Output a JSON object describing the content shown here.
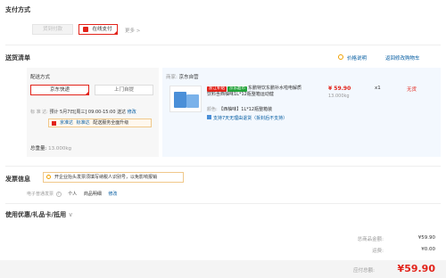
{
  "payment": {
    "title": "支付方式",
    "opt_cod": "货到付款",
    "opt_online": "在线支付",
    "more": "更多 >"
  },
  "delivery": {
    "title": "送货清单",
    "price_note": "价格说明",
    "back_cart": "返回修改购物车",
    "method_title": "配送方式",
    "opt_jd": "京东快递",
    "opt_pickup": "上门自提",
    "std_label": "标 准 达:",
    "std_time": "预计 5月7日[周三] 09:00-15:00 送达",
    "std_edit": "修改",
    "bar_text": "京准达 · 标准达 · 配送服务全面升级",
    "bar_jzd": "京准达",
    "bar_bzd": "标准达",
    "bar_up": "配送服务全面升级",
    "total_weight_label": "总重量:",
    "total_weight": "13.000kg"
  },
  "seller": {
    "label": "商家:",
    "name": "京东自营"
  },
  "product": {
    "tag1": "浙江补贴",
    "tag2": "京东超市",
    "title": "东鹏特饮东鹏补水啦电解质饮料含西柚味1L*12瓶整箱运动健",
    "price": "¥ 59.90",
    "qty": "x1",
    "stock": "无货",
    "weight": "13.000kg",
    "color_label": "颜色:",
    "color_value": "【西柚味】1L*12瓶整箱装",
    "service": "支持7天无理由退货（拆封后不支持）"
  },
  "invoice": {
    "title": "发票信息",
    "notice": "开企业抬头发票须填写纳税人识别号，以免影响报销",
    "type": "电子普通发票",
    "person": "个人",
    "detail": "商品明细",
    "edit": "修改"
  },
  "coupon": {
    "title": "使用优惠/礼品卡/抵用"
  },
  "summary": {
    "total_label": "总商品金额:",
    "total_value": "¥59.90",
    "freight_label": "运费:",
    "freight_value": "¥0.00",
    "pay_label": "应付总额:",
    "pay_value": "¥59.90"
  },
  "colors": {
    "accent_red": "#e2231a",
    "link_blue": "#005aa0",
    "panel_bg": "#f3f8fe",
    "left_bg": "#f7f7f7"
  }
}
